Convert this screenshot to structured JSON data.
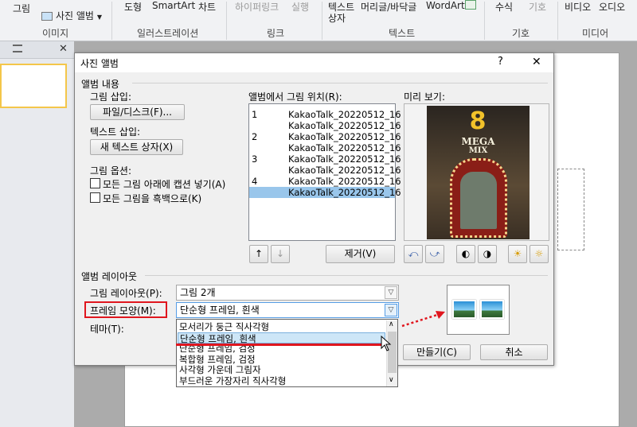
{
  "ribbon": {
    "picture": "그림",
    "photo_album": "사진 앨범",
    "shapes": "도형",
    "smartart": "SmartArt",
    "chart": "차트",
    "hyperlink": "하이퍼링크",
    "action": "실행",
    "textbox": "텍스트",
    "textbox2": "상자",
    "header_footer": "머리글/바닥글",
    "wordart": "WordArt",
    "equation": "수식",
    "symbol": "기호",
    "video": "비디오",
    "audio": "오디오",
    "groups": {
      "images": "이미지",
      "illustrations": "일러스트레이션",
      "links": "링크",
      "text": "텍스트",
      "symbols": "기호",
      "media": "미디어"
    }
  },
  "dialog": {
    "title": "사진 앨범",
    "help": "?",
    "close": "✕",
    "album_content": "앨범 내용",
    "insert_picture_from": "그림 삽입:",
    "file_disk_button": "파일/디스크(F)...",
    "insert_text": "텍스트 삽입:",
    "new_textbox_button": "새 텍스트 상자(X)",
    "picture_options": "그림 옵션:",
    "opt_caption": "모든 그림 아래에 캡션 넣기(A)",
    "opt_bw": "모든 그림을 흑백으로(K)",
    "pictures_in_album": "앨범에서 그림 위치(R):",
    "preview": "미리 보기:",
    "remove_button": "제거(V)",
    "album_layout": "앨범 레이아웃",
    "picture_layout_label": "그림 레이아웃(P):",
    "picture_layout_value": "그림 2개",
    "frame_shape_label": "프레임 모양(M):",
    "frame_shape_value": "단순형 프레임, 흰색",
    "theme_label": "테마(T):",
    "create_button": "만들기(C)",
    "cancel_button": "취소"
  },
  "album_list": [
    {
      "num": "1",
      "file": "KakaoTalk_20220512_16"
    },
    {
      "num": "",
      "file": "KakaoTalk_20220512_16"
    },
    {
      "num": "2",
      "file": "KakaoTalk_20220512_16"
    },
    {
      "num": "",
      "file": "KakaoTalk_20220512_16"
    },
    {
      "num": "3",
      "file": "KakaoTalk_20220512_16"
    },
    {
      "num": "",
      "file": "KakaoTalk_20220512_16"
    },
    {
      "num": "4",
      "file": "KakaoTalk_20220512_16"
    },
    {
      "num": "",
      "file": "KakaoTalk_20220512_16"
    }
  ],
  "selected_album_index": 7,
  "preview_photo": {
    "big_text": "8",
    "text": "MEGA",
    "text2": "MIX"
  },
  "frame_options": [
    "모서리가 둥근 직사각형",
    "단순형 프레임, 흰색",
    "단순형 프레임, 검정",
    "복합형 프레임, 검정",
    "사각형 가운데 그림자",
    "부드러운 가장자리 직사각형"
  ],
  "highlighted_frame_index": 1,
  "colors": {
    "highlight_red": "#e0161e",
    "selection_blue": "#99c6eb"
  }
}
